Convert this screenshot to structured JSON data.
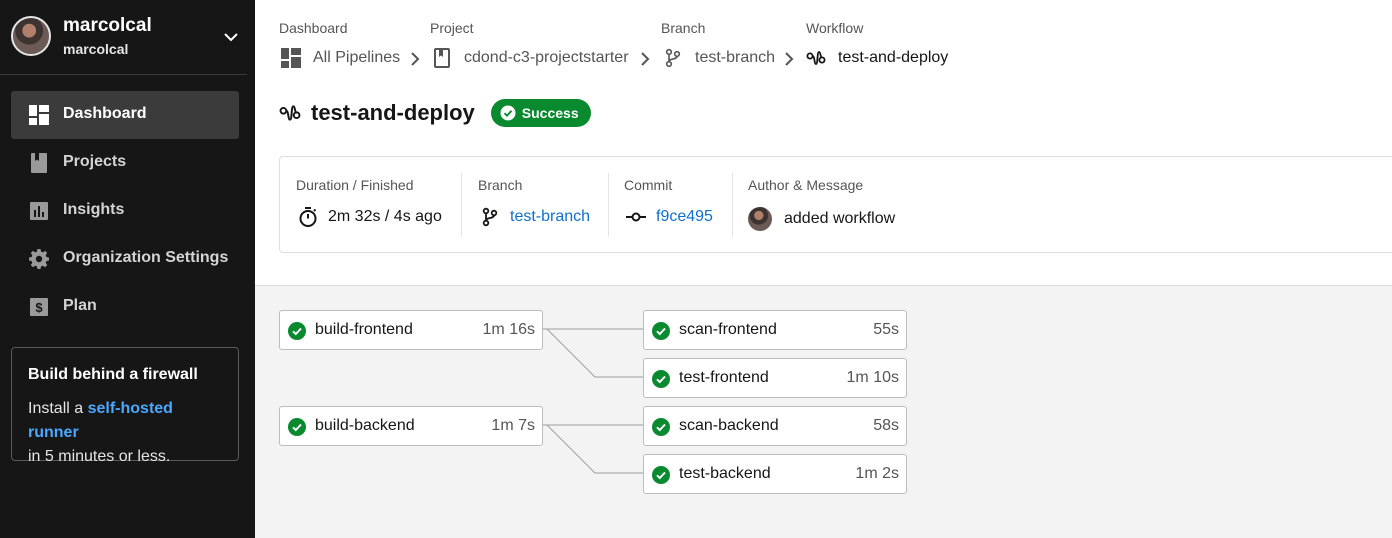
{
  "org": {
    "name": "marcolcal",
    "sub": "marcolcal"
  },
  "nav": [
    {
      "label": "Dashboard",
      "icon": "dashboard-icon",
      "active": true
    },
    {
      "label": "Projects",
      "icon": "bookmark-icon"
    },
    {
      "label": "Insights",
      "icon": "insights-icon"
    },
    {
      "label": "Organization Settings",
      "icon": "gear-icon"
    },
    {
      "label": "Plan",
      "icon": "dollar-icon"
    }
  ],
  "promo": {
    "title": "Build behind a firewall",
    "text_before": "Install a ",
    "link": "self-hosted runner",
    "text_after": "in 5 minutes or less."
  },
  "breadcrumbs": [
    {
      "caption": "Dashboard",
      "label": "All Pipelines",
      "icon": "dashboard-icon"
    },
    {
      "caption": "Project",
      "label": "cdond-c3-projectstarter",
      "icon": "bookmark-icon"
    },
    {
      "caption": "Branch",
      "label": "test-branch",
      "icon": "branch-icon"
    },
    {
      "caption": "Workflow",
      "label": "test-and-deploy",
      "icon": "workflow-icon"
    }
  ],
  "workflow": {
    "title": "test-and-deploy",
    "status": "Success"
  },
  "info": {
    "duration_caption": "Duration / Finished",
    "duration_value": "2m 32s / 4s ago",
    "branch_caption": "Branch",
    "branch_value": "test-branch",
    "commit_caption": "Commit",
    "commit_value": "f9ce495",
    "author_caption": "Author & Message",
    "author_message": "added workflow"
  },
  "jobs": [
    {
      "name": "build-frontend",
      "duration": "1m 16s",
      "status": "success"
    },
    {
      "name": "scan-frontend",
      "duration": "55s",
      "status": "success"
    },
    {
      "name": "test-frontend",
      "duration": "1m 10s",
      "status": "success"
    },
    {
      "name": "build-backend",
      "duration": "1m 7s",
      "status": "success"
    },
    {
      "name": "scan-backend",
      "duration": "58s",
      "status": "success"
    },
    {
      "name": "test-backend",
      "duration": "1m 2s",
      "status": "success"
    }
  ],
  "colors": {
    "sidebar": "#161616",
    "success": "#0a8a2e",
    "link": "#0f6fcf",
    "promo_link": "#4aa8ff"
  }
}
